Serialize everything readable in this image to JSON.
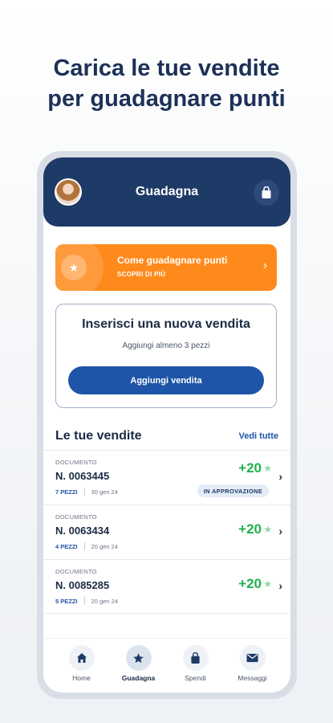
{
  "headline": {
    "line1": "Carica le tue vendite",
    "line2": "per guadagnare punti"
  },
  "topbar": {
    "title": "Guadagna"
  },
  "promo": {
    "title": "Come guadagnare punti",
    "subtitle": "SCOPRI DI PIÙ"
  },
  "new_sale": {
    "title": "Inserisci una nuova vendita",
    "subtitle": "Aggiungi almeno 3 pezzi",
    "button_label": "Aggiungi vendita"
  },
  "sales": {
    "title": "Le tue vendite",
    "see_all": "Vedi tutte",
    "items": [
      {
        "doc_label": "DOCUMENTO",
        "number": "N. 0063445",
        "pieces": "7 PEZZI",
        "date": "30 gen 24",
        "points": "+20",
        "status": "IN APPROVAZIONE"
      },
      {
        "doc_label": "DOCUMENTO",
        "number": "N. 0063434",
        "pieces": "4 PEZZI",
        "date": "20 gen 24",
        "points": "+20"
      },
      {
        "doc_label": "DOCUMENTO",
        "number": "N. 0085285",
        "pieces": "5 PEZZI",
        "date": "20 gen 24",
        "points": "+20"
      }
    ]
  },
  "nav": {
    "items": [
      {
        "label": "Home",
        "icon": "home-icon"
      },
      {
        "label": "Guadagna",
        "icon": "star-icon",
        "active": true
      },
      {
        "label": "Spendi",
        "icon": "shopping-bag-icon"
      },
      {
        "label": "Messaggi",
        "icon": "mail-icon"
      }
    ]
  },
  "colors": {
    "navy": "#1e3a66",
    "orange": "#ff8a1c",
    "blue_button": "#1f55a8",
    "points_green": "#1fb14b"
  }
}
